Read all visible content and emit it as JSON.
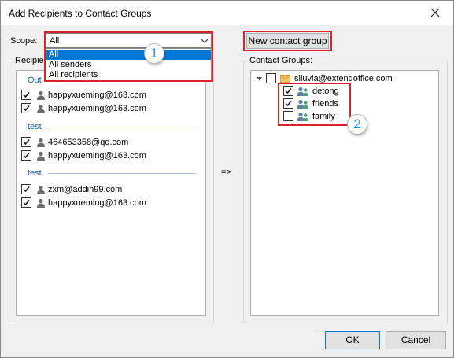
{
  "window": {
    "title": "Add Recipients to Contact Groups"
  },
  "scope": {
    "label": "Scope:",
    "selected": "All",
    "options": [
      "All",
      "All senders",
      "All recipients"
    ]
  },
  "recipients": {
    "label": "Recipien",
    "sections": [
      {
        "title": "Out",
        "items": [
          {
            "email": "happyxueming@163.com",
            "checked": true
          },
          {
            "email": "happyxueming@163.com",
            "checked": true
          }
        ]
      },
      {
        "title": "test",
        "items": [
          {
            "email": "464653358@qq.com",
            "checked": true
          },
          {
            "email": "happyxueming@163.com",
            "checked": true
          }
        ]
      },
      {
        "title": "test",
        "items": [
          {
            "email": "zxm@addin99.com",
            "checked": true
          },
          {
            "email": "happyxueming@163.com",
            "checked": true
          }
        ]
      }
    ]
  },
  "arrow_label": "=>",
  "new_group_button": "New contact group",
  "contact_groups": {
    "label": "Contact Groups:",
    "root": "siluvia@extendoffice.com",
    "groups": [
      {
        "name": "detong",
        "checked": true
      },
      {
        "name": "friends",
        "checked": true
      },
      {
        "name": "family",
        "checked": false
      }
    ]
  },
  "callouts": {
    "one": "1",
    "two": "2"
  },
  "buttons": {
    "ok": "OK",
    "cancel": "Cancel"
  },
  "colors": {
    "accent": "#0078d7",
    "highlight": "#d8232a",
    "callout_text": "#2e8ce0",
    "section_title": "#1f5fa8"
  }
}
